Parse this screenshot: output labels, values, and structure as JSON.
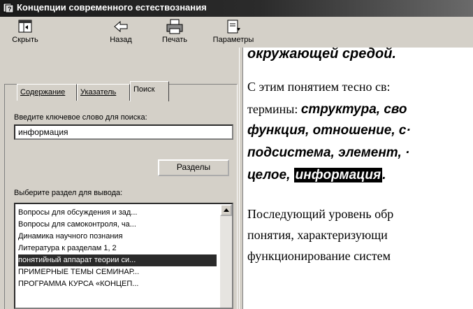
{
  "window": {
    "title": "Концепции современного естествознания"
  },
  "toolbar": {
    "hide": "Скрыть",
    "back": "Назад",
    "print": "Печать",
    "options": "Параметры"
  },
  "tabs": {
    "contents": "Содержание",
    "index": "Указатель",
    "search": "Поиск"
  },
  "search": {
    "prompt": "Введите ключевое слово для поиска:",
    "value": "информация",
    "topics_button": "Разделы",
    "select_label": "Выберите раздел для вывода:"
  },
  "results": [
    "Вопросы для обсуждения и зад...",
    "Вопросы для самоконтроля, ча...",
    "Динамика научного познания",
    "Литература к разделам 1, 2",
    "понятийный аппарат теории си...",
    "ПРИМЕРНЫЕ ТЕМЫ СЕМИНАР...",
    "ПРОГРАММА КУРСА «КОНЦЕП..."
  ],
  "content": {
    "line1": "окружающей средой.",
    "line2": "С этим понятием тесно св:",
    "line3_a": "термины: ",
    "line3_b": "структура, сво",
    "line4": "функция, отношение, с·",
    "line5": "подсистема, элемент, ·",
    "line6_a": "целое, ",
    "line6_hl": "информация",
    "line6_b": ".",
    "line7": "Последующий уровень обр",
    "line8": "понятия, характеризующи",
    "line9": "функционирование систем"
  }
}
